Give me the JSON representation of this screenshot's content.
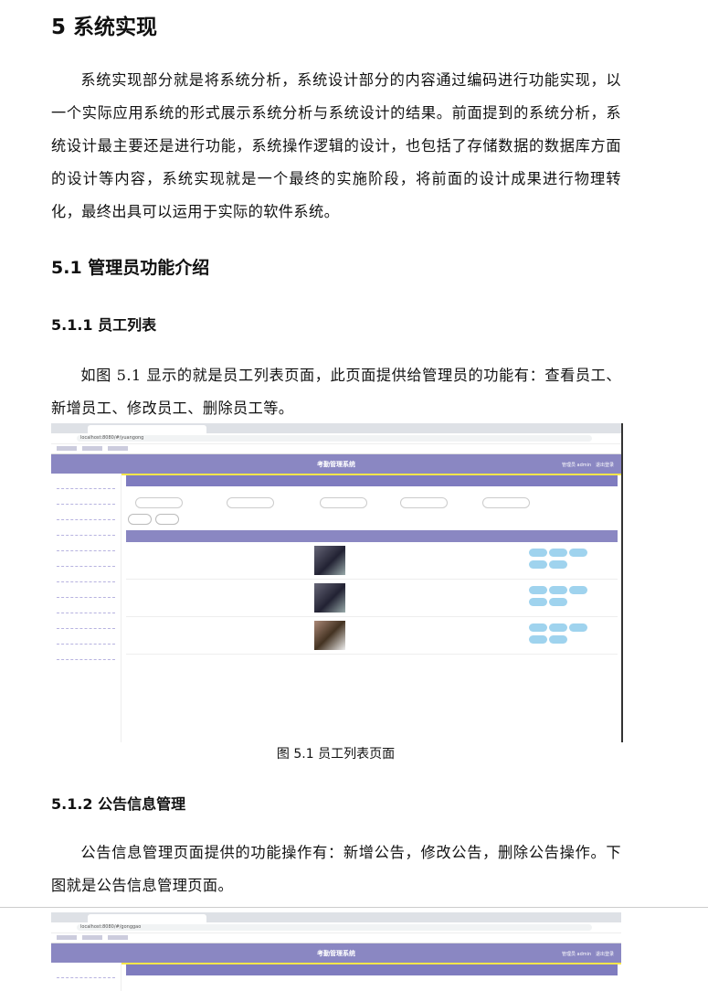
{
  "heading_chapter": "5  系统实现",
  "intro": "系统实现部分就是将系统分析，系统设计部分的内容通过编码进行功能实现，以一个实际应用系统的形式展示系统分析与系统设计的结果。前面提到的系统分析，系统设计最主要还是进行功能，系统操作逻辑的设计，也包括了存储数据的数据库方面的设计等内容，系统实现就是一个最终的实施阶段，将前面的设计成果进行物理转化，最终出具可以运用于实际的软件系统。",
  "heading_section": "5.1  管理员功能介绍",
  "heading_sub1": "5.1.1  员工列表",
  "para_sub1": "如图 5.1 显示的就是员工列表页面，此页面提供给管理员的功能有：查看员工、新增员工、修改员工、删除员工等。",
  "figure1": {
    "app_title": "考勤管理系统",
    "url": "localhost:8080/#/yuangong",
    "user": "管理员 admin",
    "logout": "退出登录"
  },
  "caption1": "图 5.1  员工列表页面",
  "heading_sub2": "5.1.2  公告信息管理",
  "para_sub2": "公告信息管理页面提供的功能操作有：新增公告，修改公告，删除公告操作。下图就是公告信息管理页面。",
  "figure2": {
    "app_title": "考勤管理系统",
    "url": "localhost:8080/#/gonggao",
    "user": "管理员 admin",
    "logout": "退出登录"
  }
}
